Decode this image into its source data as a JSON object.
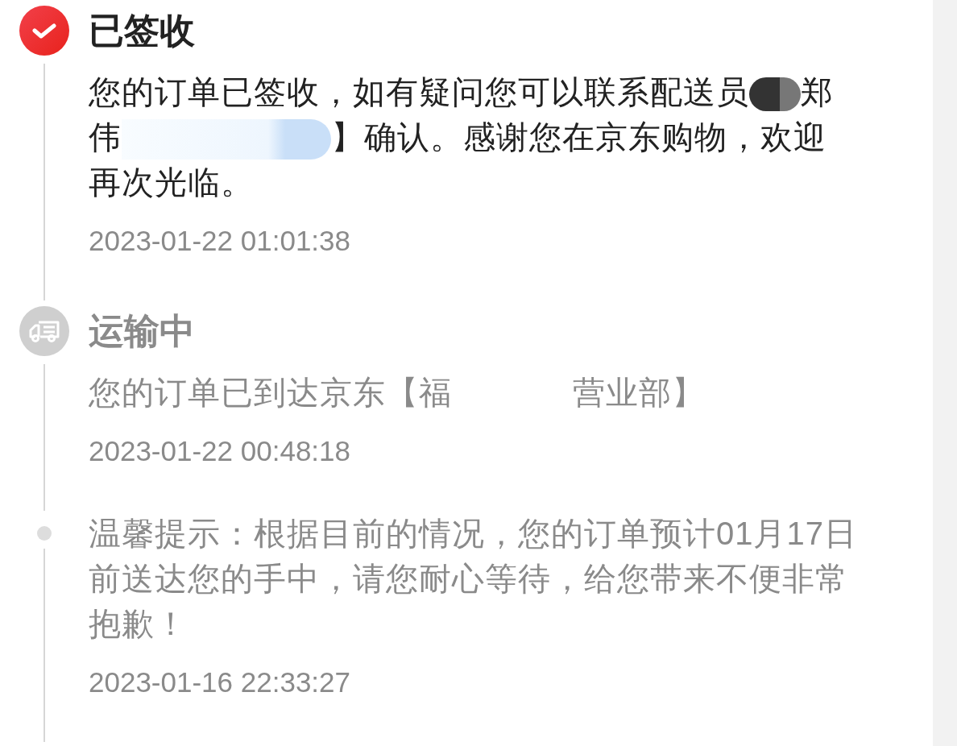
{
  "timeline": [
    {
      "kind": "delivered",
      "active": true,
      "title": "已签收",
      "lines": [
        [
          {
            "kind": "text",
            "text": "您的订单已签收，如有疑问您可以联系配送员"
          },
          {
            "kind": "dark_mask"
          },
          {
            "kind": "text",
            "text": "郑"
          }
        ],
        [
          {
            "kind": "text",
            "text": "伟"
          },
          {
            "kind": "light_mask"
          },
          {
            "kind": "text",
            "text": "】确认。感谢您在京东购物，欢迎"
          }
        ],
        [
          {
            "kind": "text",
            "text": "再次光临。"
          }
        ]
      ],
      "time": "2023-01-22 01:01:38"
    },
    {
      "kind": "transit",
      "active": false,
      "title": "运输中",
      "lines": [
        [
          {
            "kind": "text",
            "text": "您的订单已到达京东【福"
          },
          {
            "kind": "text",
            "text": "营业部】"
          }
        ]
      ],
      "time": "2023-01-22 00:48:18"
    },
    {
      "kind": "note",
      "active": false,
      "lines": [
        [
          {
            "kind": "text",
            "text": "温馨提示：根据目前的情况，您的订单预计01月17日"
          }
        ],
        [
          {
            "kind": "text",
            "text": "前送达您的手中，请您耐心等待，给您带来不便非常"
          }
        ],
        [
          {
            "kind": "text",
            "text": "抱歉！"
          }
        ]
      ],
      "time": "2023-01-16 22:33:27"
    }
  ]
}
